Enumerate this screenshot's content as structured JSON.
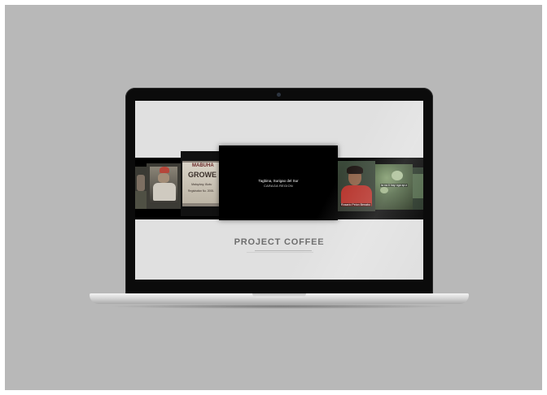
{
  "page": {
    "title": "PROJECT COFFEE"
  },
  "center_slide": {
    "location": "Tagbina, Surigao del Sur",
    "region": "CARAGA REGION"
  },
  "slides": [
    {
      "id": "far-left",
      "caption": ""
    },
    {
      "id": "farmer-sitting",
      "caption": ""
    },
    {
      "id": "growers-sign",
      "sign_line1": "MABUHA",
      "sign_line2": "GROWE",
      "sign_line3": "Malaybay, Buku",
      "sign_line4": "Registration No. 2008-"
    },
    {
      "id": "woman-portrait",
      "subtitle": "Rosario Pelon Benabo"
    },
    {
      "id": "coffee-plants",
      "subtitle": "ta na ti hay nga sp:z"
    },
    {
      "id": "far-right",
      "caption": ""
    }
  ],
  "colors": {
    "backdrop": "#b8b8b8",
    "screen_bg": "#e0e0e0",
    "title_color": "#6e6e6e",
    "band": "#000000"
  }
}
